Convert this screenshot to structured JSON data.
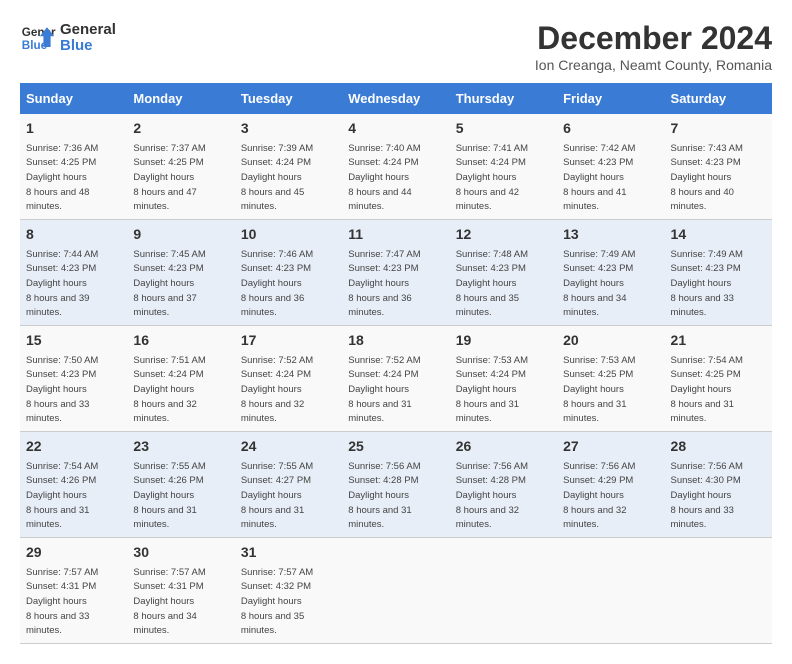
{
  "header": {
    "logo_line1": "General",
    "logo_line2": "Blue",
    "month": "December 2024",
    "location": "Ion Creanga, Neamt County, Romania"
  },
  "days_of_week": [
    "Sunday",
    "Monday",
    "Tuesday",
    "Wednesday",
    "Thursday",
    "Friday",
    "Saturday"
  ],
  "weeks": [
    [
      {
        "day": "1",
        "sunrise": "7:36 AM",
        "sunset": "4:25 PM",
        "daylight": "8 hours and 48 minutes."
      },
      {
        "day": "2",
        "sunrise": "7:37 AM",
        "sunset": "4:25 PM",
        "daylight": "8 hours and 47 minutes."
      },
      {
        "day": "3",
        "sunrise": "7:39 AM",
        "sunset": "4:24 PM",
        "daylight": "8 hours and 45 minutes."
      },
      {
        "day": "4",
        "sunrise": "7:40 AM",
        "sunset": "4:24 PM",
        "daylight": "8 hours and 44 minutes."
      },
      {
        "day": "5",
        "sunrise": "7:41 AM",
        "sunset": "4:24 PM",
        "daylight": "8 hours and 42 minutes."
      },
      {
        "day": "6",
        "sunrise": "7:42 AM",
        "sunset": "4:23 PM",
        "daylight": "8 hours and 41 minutes."
      },
      {
        "day": "7",
        "sunrise": "7:43 AM",
        "sunset": "4:23 PM",
        "daylight": "8 hours and 40 minutes."
      }
    ],
    [
      {
        "day": "8",
        "sunrise": "7:44 AM",
        "sunset": "4:23 PM",
        "daylight": "8 hours and 39 minutes."
      },
      {
        "day": "9",
        "sunrise": "7:45 AM",
        "sunset": "4:23 PM",
        "daylight": "8 hours and 37 minutes."
      },
      {
        "day": "10",
        "sunrise": "7:46 AM",
        "sunset": "4:23 PM",
        "daylight": "8 hours and 36 minutes."
      },
      {
        "day": "11",
        "sunrise": "7:47 AM",
        "sunset": "4:23 PM",
        "daylight": "8 hours and 36 minutes."
      },
      {
        "day": "12",
        "sunrise": "7:48 AM",
        "sunset": "4:23 PM",
        "daylight": "8 hours and 35 minutes."
      },
      {
        "day": "13",
        "sunrise": "7:49 AM",
        "sunset": "4:23 PM",
        "daylight": "8 hours and 34 minutes."
      },
      {
        "day": "14",
        "sunrise": "7:49 AM",
        "sunset": "4:23 PM",
        "daylight": "8 hours and 33 minutes."
      }
    ],
    [
      {
        "day": "15",
        "sunrise": "7:50 AM",
        "sunset": "4:23 PM",
        "daylight": "8 hours and 33 minutes."
      },
      {
        "day": "16",
        "sunrise": "7:51 AM",
        "sunset": "4:24 PM",
        "daylight": "8 hours and 32 minutes."
      },
      {
        "day": "17",
        "sunrise": "7:52 AM",
        "sunset": "4:24 PM",
        "daylight": "8 hours and 32 minutes."
      },
      {
        "day": "18",
        "sunrise": "7:52 AM",
        "sunset": "4:24 PM",
        "daylight": "8 hours and 31 minutes."
      },
      {
        "day": "19",
        "sunrise": "7:53 AM",
        "sunset": "4:24 PM",
        "daylight": "8 hours and 31 minutes."
      },
      {
        "day": "20",
        "sunrise": "7:53 AM",
        "sunset": "4:25 PM",
        "daylight": "8 hours and 31 minutes."
      },
      {
        "day": "21",
        "sunrise": "7:54 AM",
        "sunset": "4:25 PM",
        "daylight": "8 hours and 31 minutes."
      }
    ],
    [
      {
        "day": "22",
        "sunrise": "7:54 AM",
        "sunset": "4:26 PM",
        "daylight": "8 hours and 31 minutes."
      },
      {
        "day": "23",
        "sunrise": "7:55 AM",
        "sunset": "4:26 PM",
        "daylight": "8 hours and 31 minutes."
      },
      {
        "day": "24",
        "sunrise": "7:55 AM",
        "sunset": "4:27 PM",
        "daylight": "8 hours and 31 minutes."
      },
      {
        "day": "25",
        "sunrise": "7:56 AM",
        "sunset": "4:28 PM",
        "daylight": "8 hours and 31 minutes."
      },
      {
        "day": "26",
        "sunrise": "7:56 AM",
        "sunset": "4:28 PM",
        "daylight": "8 hours and 32 minutes."
      },
      {
        "day": "27",
        "sunrise": "7:56 AM",
        "sunset": "4:29 PM",
        "daylight": "8 hours and 32 minutes."
      },
      {
        "day": "28",
        "sunrise": "7:56 AM",
        "sunset": "4:30 PM",
        "daylight": "8 hours and 33 minutes."
      }
    ],
    [
      {
        "day": "29",
        "sunrise": "7:57 AM",
        "sunset": "4:31 PM",
        "daylight": "8 hours and 33 minutes."
      },
      {
        "day": "30",
        "sunrise": "7:57 AM",
        "sunset": "4:31 PM",
        "daylight": "8 hours and 34 minutes."
      },
      {
        "day": "31",
        "sunrise": "7:57 AM",
        "sunset": "4:32 PM",
        "daylight": "8 hours and 35 minutes."
      },
      null,
      null,
      null,
      null
    ]
  ]
}
